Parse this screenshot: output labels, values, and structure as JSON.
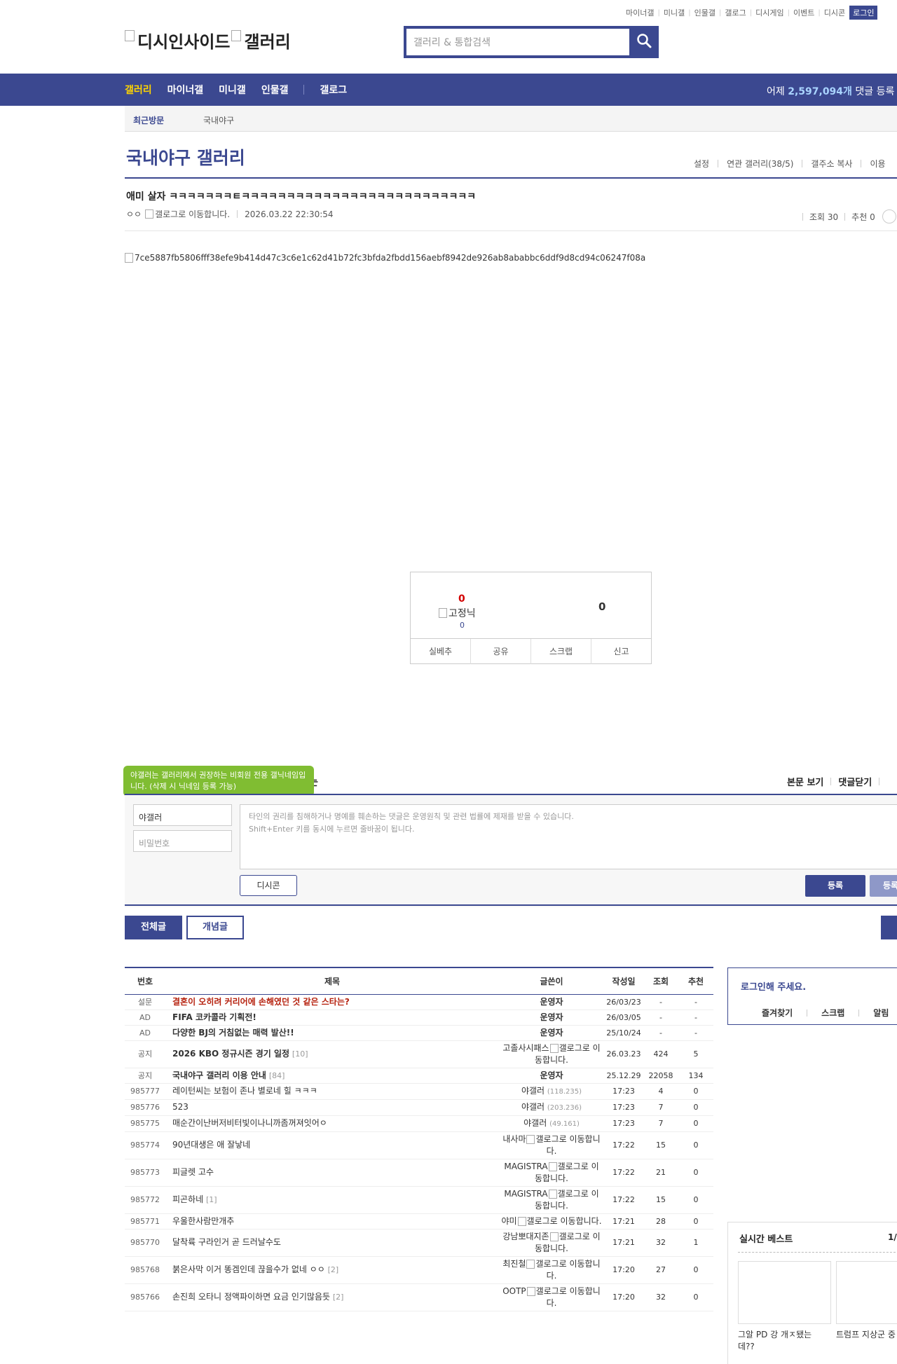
{
  "util_links": [
    "마이너갤",
    "미니갤",
    "인물갤",
    "갤로그",
    "디시게임",
    "이벤트",
    "디시콘"
  ],
  "login_label": "로그인",
  "logo": {
    "part1": "디시인사이드",
    "part2": "갤러리"
  },
  "search": {
    "placeholder": "갤러리 & 통합검색"
  },
  "gnb": {
    "items": [
      "갤러리",
      "마이너갤",
      "미니갤",
      "인물갤",
      "갤로그"
    ],
    "count_prefix": "어제 ",
    "count_value": "2,597,094개",
    "count_suffix": " 댓글 등록"
  },
  "recent": {
    "label": "최근방문",
    "item": "국내야구"
  },
  "gallery": {
    "title": "국내야구 갤러리",
    "tools": [
      "설정",
      "연관 갤러리(38/5)",
      "갤주소 복사",
      "이용"
    ]
  },
  "post": {
    "title": "애미 살자 ㅋㅋㅋㅋㅋㅋㅋㅌㅋㅋㅋㅋㅋㅋㅋㅋㅋㅋㅋㅋㅋㅋㅋㅋㅋㅋㅋㅋㅋㅋㅋㅋㅋㅋ",
    "writer": "ㅇㅇ",
    "gallog_alt": "갤로그로 이동합니다.",
    "date": "2026.03.22 22:30:54",
    "views": "조회 30",
    "recommend": "추천 0",
    "image_alt": "7ce5887fb5806fff38efe9b414d47c3c6e1c62d41b72fc3bfda2fbdd156aebf8942de926ab8ababbc6ddf9d8cd94c06247f08a"
  },
  "vote": {
    "up": "0",
    "fixed_label": "고정닉",
    "fixed_count": "0",
    "down": "0",
    "buttons": [
      "실베추",
      "공유",
      "스크랩",
      "신고"
    ]
  },
  "comment": {
    "tooltip": "야갤러는 갤러리에서 권장하는 비회원 전용 갤닉네임입니다. (삭제 시 닉네임 등록 가능)",
    "title_tail": "는",
    "view_post": "본문 보기",
    "close_comments": "댓글닫기",
    "nickname": "야갤러",
    "password_placeholder": "비밀번호",
    "notice_line1": "타인의 권리를 침해하거나 명예를 훼손하는 댓글은 운영원칙 및 관련 법률에 제재를 받을 수 있습니다.",
    "notice_line2": "Shift+Enter 키를 동시에 누르면 줄바꿈이 됩니다.",
    "dccon": "디시콘",
    "submit": "등록",
    "submit2": "등록"
  },
  "tabs": {
    "all": "전체글",
    "concept": "개념글"
  },
  "list": {
    "headers": [
      "번호",
      "제목",
      "글쓴이",
      "작성일",
      "조회",
      "추천"
    ],
    "rows": [
      {
        "no": "설문",
        "subject": "결혼이 오히려 커리어에 손해였던 것 같은 스타는?",
        "cnt": "",
        "writer": "운영자",
        "ip": "",
        "gallog": false,
        "date": "26/03/23",
        "view": "-",
        "rec": "-",
        "style": "red"
      },
      {
        "no": "AD",
        "subject": "FIFA 코카콜라 기획전!",
        "cnt": "",
        "writer": "운영자",
        "ip": "",
        "gallog": false,
        "date": "26/03/05",
        "view": "-",
        "rec": "-",
        "style": "bold"
      },
      {
        "no": "AD",
        "subject": "다양한 BJ의 거침없는 매력 발산!!",
        "cnt": "",
        "writer": "운영자",
        "ip": "",
        "gallog": false,
        "date": "25/10/24",
        "view": "-",
        "rec": "-",
        "style": "bold"
      },
      {
        "no": "공지",
        "subject": "2026 KBO 정규시즌 경기 일정",
        "cnt": "[10]",
        "writer": "고졸사시패스",
        "ip": "",
        "gallog": true,
        "date": "26.03.23",
        "view": "424",
        "rec": "5",
        "style": "bold"
      },
      {
        "no": "공지",
        "subject": "국내야구 갤러리 이용 안내",
        "cnt": "[84]",
        "writer": "운영자",
        "ip": "",
        "gallog": false,
        "date": "25.12.29",
        "view": "22058",
        "rec": "134",
        "style": "bold"
      },
      {
        "no": "985777",
        "subject": "레이턴씨는 보험이 존나 별로네 힐 ㅋㅋㅋ",
        "cnt": "",
        "writer": "야갤러",
        "ip": "(118.235)",
        "gallog": false,
        "date": "17:23",
        "view": "4",
        "rec": "0",
        "style": ""
      },
      {
        "no": "985776",
        "subject": "523",
        "cnt": "",
        "writer": "야갤러",
        "ip": "(203.236)",
        "gallog": false,
        "date": "17:23",
        "view": "7",
        "rec": "0",
        "style": ""
      },
      {
        "no": "985775",
        "subject": "매순간이난버저비터빛이나니까좀꺼져잇어ㅇ",
        "cnt": "",
        "writer": "야갤러",
        "ip": "(49.161)",
        "gallog": false,
        "date": "17:23",
        "view": "7",
        "rec": "0",
        "style": ""
      },
      {
        "no": "985774",
        "subject": "90년대생은 애 잘낳네",
        "cnt": "",
        "writer": "내사마",
        "ip": "",
        "gallog": true,
        "date": "17:22",
        "view": "15",
        "rec": "0",
        "style": ""
      },
      {
        "no": "985773",
        "subject": "피글렛 고수",
        "cnt": "",
        "writer": "MAGISTRA",
        "ip": "",
        "gallog": true,
        "date": "17:22",
        "view": "21",
        "rec": "0",
        "style": ""
      },
      {
        "no": "985772",
        "subject": "피곤하네",
        "cnt": "[1]",
        "writer": "MAGISTRA",
        "ip": "",
        "gallog": true,
        "date": "17:22",
        "view": "15",
        "rec": "0",
        "style": ""
      },
      {
        "no": "985771",
        "subject": "우울한사람만개추",
        "cnt": "",
        "writer": "야미",
        "ip": "",
        "gallog": true,
        "date": "17:21",
        "view": "28",
        "rec": "0",
        "style": ""
      },
      {
        "no": "985770",
        "subject": "달착륙 구라인거 곧 드러날수도",
        "cnt": "",
        "writer": "강남뽀대지존",
        "ip": "",
        "gallog": true,
        "date": "17:21",
        "view": "32",
        "rec": "1",
        "style": ""
      },
      {
        "no": "985768",
        "subject": "붉은사막 이거 똥겜인데 끊을수가 없네 ㅇㅇ",
        "cnt": "[2]",
        "writer": "최진철",
        "ip": "",
        "gallog": true,
        "date": "17:20",
        "view": "27",
        "rec": "0",
        "style": ""
      },
      {
        "no": "985766",
        "subject": "손진희 오타니 정액파이하면 요금 인기많음듯",
        "cnt": "[2]",
        "writer": "OOTP",
        "ip": "",
        "gallog": true,
        "date": "17:20",
        "view": "32",
        "rec": "0",
        "style": ""
      }
    ]
  },
  "loginbox": {
    "title": "로그인해 주세요.",
    "links": [
      "즐겨찾기",
      "스크랩",
      "알림"
    ]
  },
  "best": {
    "title": "실시간 베스트",
    "page": "1/",
    "captions": [
      "그알 PD 강 개ㅈ됐는데??",
      "트럼프 지상군 중"
    ]
  },
  "colors": {
    "brand": "#3b4890",
    "accent_yellow": "#ffd400",
    "tooltip_green": "#80bd32",
    "notice_red": "#b6220f"
  }
}
